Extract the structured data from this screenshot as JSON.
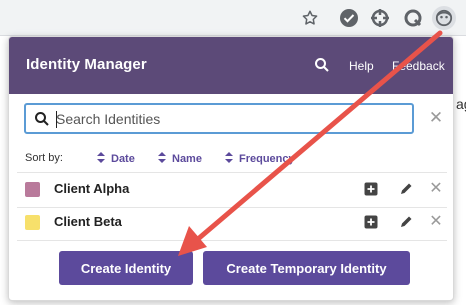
{
  "browser": {
    "toolbar_icons": [
      "star-icon",
      "checkmark-extension-icon",
      "crosshair-extension-icon",
      "q-extension-icon",
      "identity-manager-extension-icon"
    ]
  },
  "background": {
    "fragment": "ag"
  },
  "popup": {
    "title": "Identity Manager",
    "header_links": {
      "help": "Help",
      "feedback": "Feedback"
    },
    "search": {
      "placeholder": "Search Identities",
      "value": ""
    },
    "sort": {
      "label": "Sort by:",
      "options": [
        "Date",
        "Name",
        "Frequency"
      ]
    },
    "identities": [
      {
        "name": "Client Alpha",
        "color": "#b97a9b"
      },
      {
        "name": "Client Beta",
        "color": "#f7e06b"
      }
    ],
    "buttons": {
      "create": "Create Identity",
      "create_temporary": "Create Temporary Identity"
    }
  },
  "colors": {
    "header_bg": "#5c4a78",
    "accent": "#5c4a9c",
    "annotation_arrow": "#e8534a",
    "focus_border": "#5b9bd5"
  }
}
